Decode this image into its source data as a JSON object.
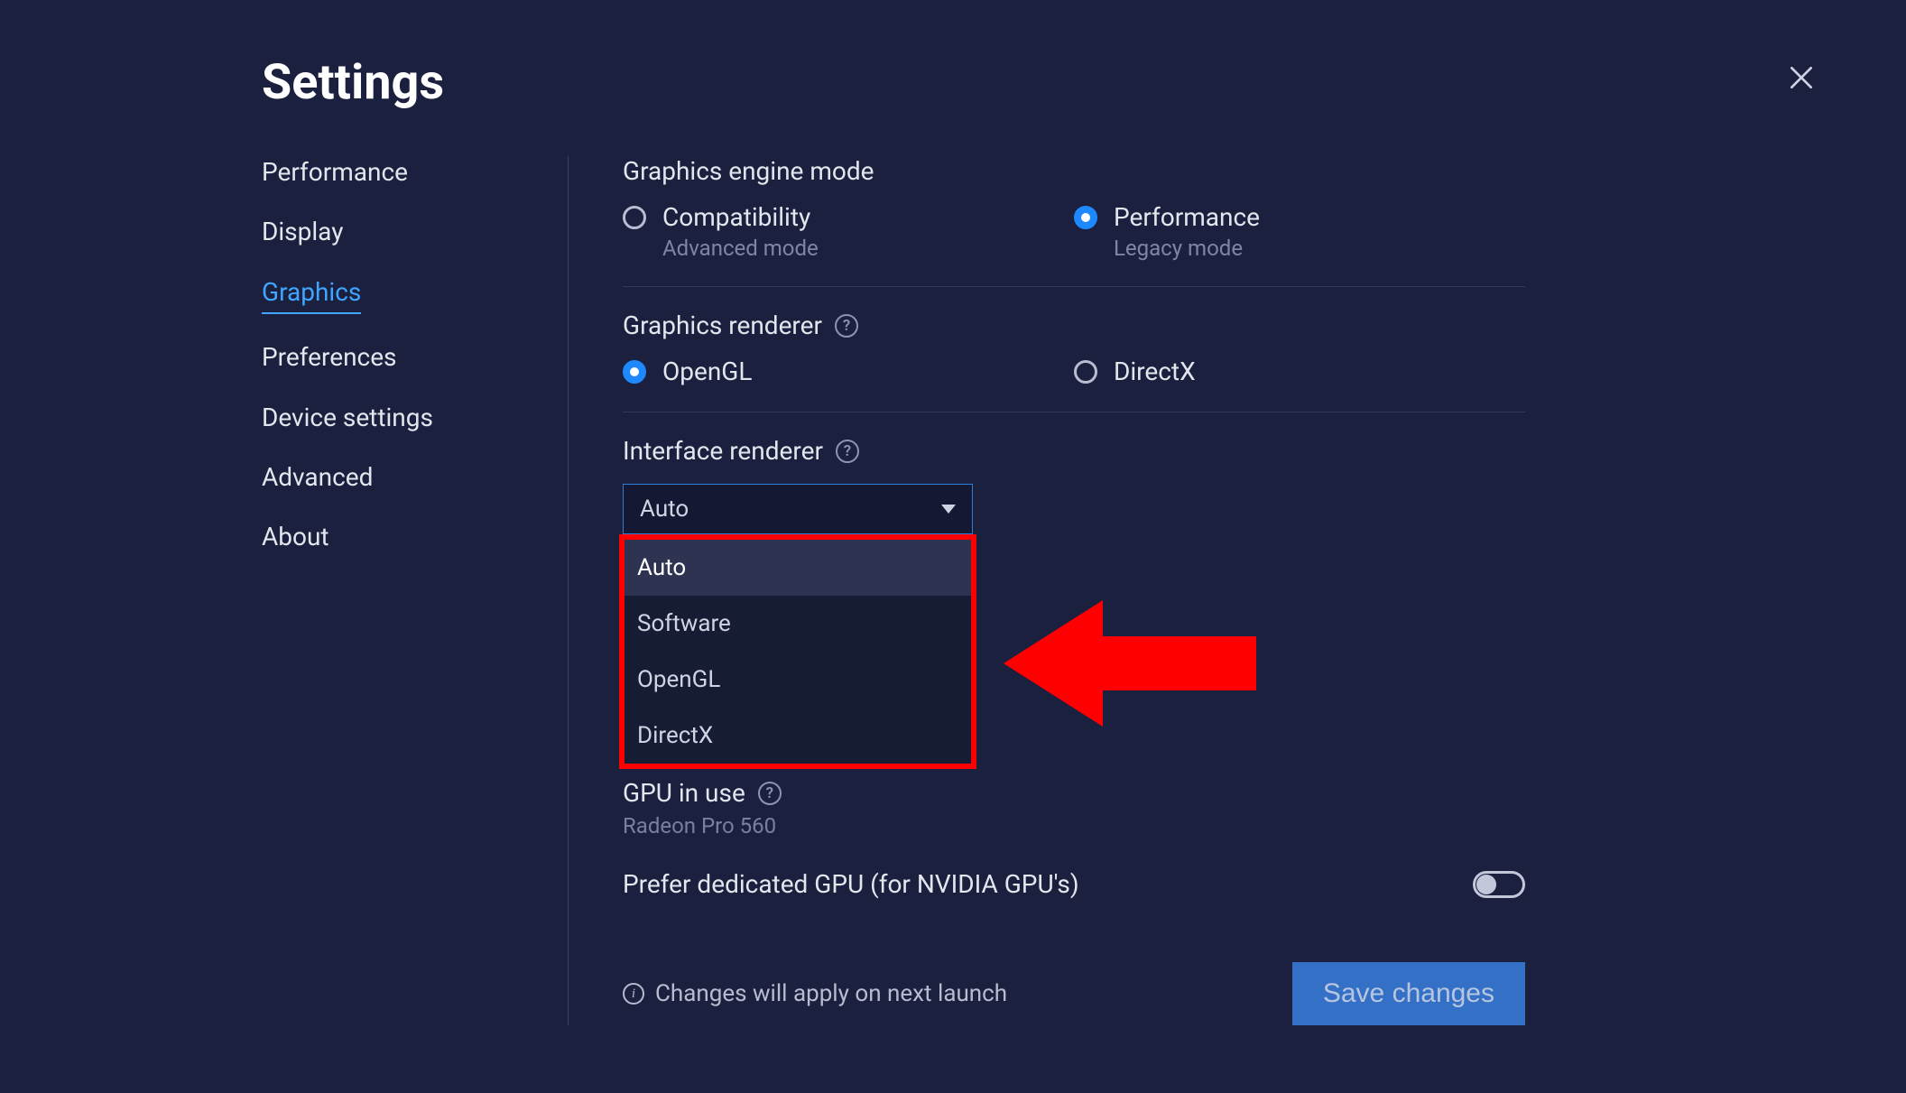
{
  "title": "Settings",
  "sidebar": {
    "items": [
      {
        "label": "Performance",
        "active": false
      },
      {
        "label": "Display",
        "active": false
      },
      {
        "label": "Graphics",
        "active": true
      },
      {
        "label": "Preferences",
        "active": false
      },
      {
        "label": "Device settings",
        "active": false
      },
      {
        "label": "Advanced",
        "active": false
      },
      {
        "label": "About",
        "active": false
      }
    ]
  },
  "engine_mode": {
    "label": "Graphics engine mode",
    "options": [
      {
        "label": "Compatibility",
        "sub": "Advanced mode",
        "selected": false
      },
      {
        "label": "Performance",
        "sub": "Legacy mode",
        "selected": true
      }
    ]
  },
  "renderer": {
    "label": "Graphics renderer",
    "help": "?",
    "options": [
      {
        "label": "OpenGL",
        "selected": true
      },
      {
        "label": "DirectX",
        "selected": false
      }
    ]
  },
  "interface_renderer": {
    "label": "Interface renderer",
    "help": "?",
    "selected": "Auto",
    "options": [
      "Auto",
      "Software",
      "OpenGL",
      "DirectX"
    ]
  },
  "gpu": {
    "label": "GPU in use",
    "help": "?",
    "value": "Radeon Pro 560",
    "prefer_dedicated_label": "Prefer dedicated GPU (for NVIDIA GPU's)",
    "prefer_dedicated": false
  },
  "footer": {
    "info": "Changes will apply on next launch",
    "save": "Save changes"
  }
}
